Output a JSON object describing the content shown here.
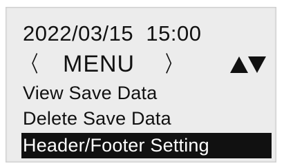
{
  "status": {
    "datetime": "2022/03/15  15:00"
  },
  "nav": {
    "prev_glyph": "〈",
    "title": "MENU",
    "next_glyph": "〉",
    "scroll_up_icon": "triangle-up",
    "scroll_down_icon": "triangle-down"
  },
  "menu": {
    "items": [
      {
        "label": "View Save Data",
        "selected": false
      },
      {
        "label": "Delete Save Data",
        "selected": false
      },
      {
        "label": "Header/Footer Setting",
        "selected": true
      }
    ]
  },
  "colors": {
    "screen_bg": "#ececec",
    "text": "#111111",
    "highlight_bg": "#111111",
    "highlight_text": "#ffffff"
  }
}
